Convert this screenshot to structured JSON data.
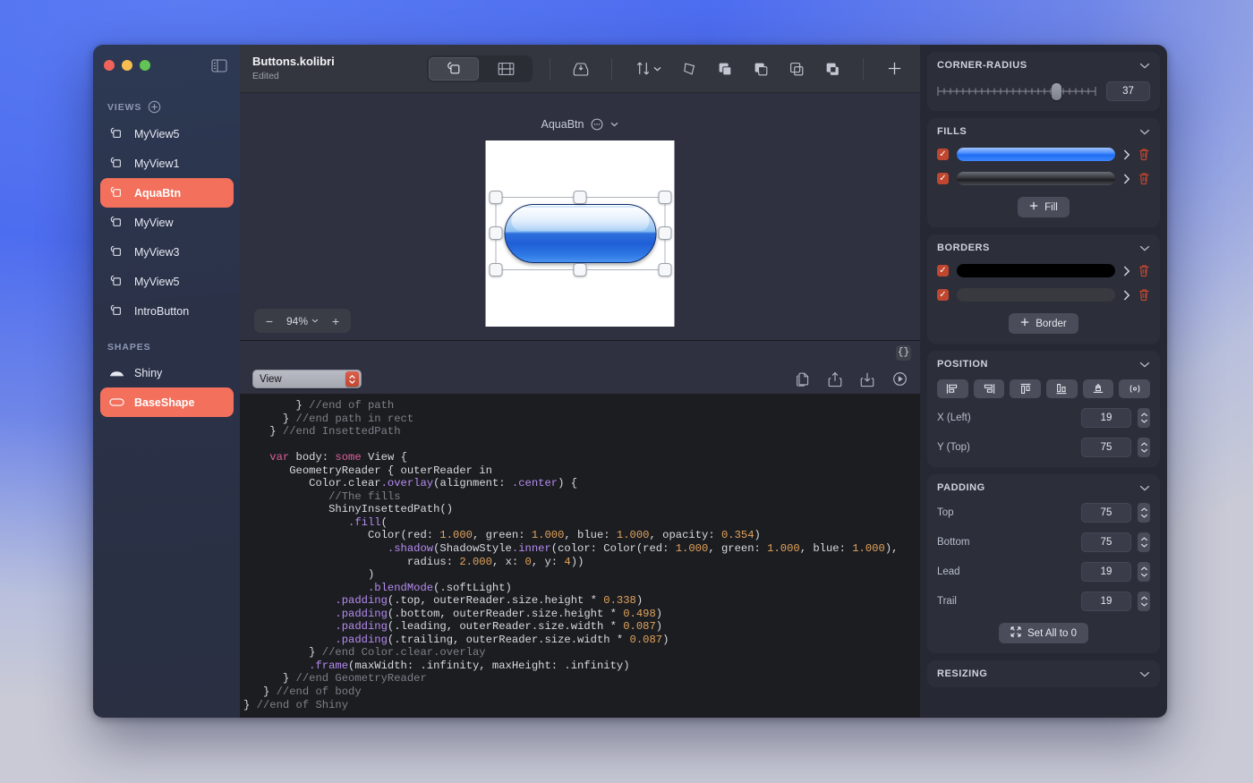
{
  "window": {
    "traffic_lights": [
      "close",
      "minimize",
      "zoom"
    ],
    "sidebar_toggle_icon": "sidebar-toggle-icon"
  },
  "sidebar": {
    "views_header": "VIEWS",
    "add_view_icon": "plus-circle-icon",
    "views": [
      {
        "label": "MyView5",
        "selected": false
      },
      {
        "label": "MyView1",
        "selected": false
      },
      {
        "label": "AquaBtn",
        "selected": true
      },
      {
        "label": "MyView",
        "selected": false
      },
      {
        "label": "MyView3",
        "selected": false
      },
      {
        "label": "MyView5",
        "selected": false
      },
      {
        "label": "IntroButton",
        "selected": false
      }
    ],
    "shapes_header": "SHAPES",
    "shapes": [
      {
        "label": "Shiny",
        "selected": false
      },
      {
        "label": "BaseShape",
        "selected": true
      }
    ]
  },
  "header": {
    "title": "Buttons.kolibri",
    "subtitle": "Edited",
    "view_mode": [
      {
        "icon": "shapes-stack-icon",
        "active": true
      },
      {
        "icon": "film-strip-icon",
        "active": false
      }
    ],
    "tools": [
      {
        "icon": "import-tray-icon",
        "label": "Import"
      },
      {
        "icon": "sort-arrows-icon",
        "label": "Sort",
        "has_chevron": true
      },
      {
        "icon": "polygon-icon",
        "label": "Polygon"
      },
      {
        "icon": "union-shapes-icon",
        "label": "Union"
      },
      {
        "icon": "subtract-shapes-icon",
        "label": "Subtract"
      },
      {
        "icon": "intersect-shapes-icon",
        "label": "Intersect"
      },
      {
        "icon": "exclude-shapes-icon",
        "label": "Exclude"
      },
      {
        "icon": "plus-icon",
        "label": "Add"
      }
    ]
  },
  "canvas": {
    "artboard_name": "AquaBtn",
    "artboard_menu_icon": "ellipsis-circle-icon",
    "artboard_chevron_icon": "chevron-down-icon",
    "zoom": {
      "minus_label": "−",
      "value": "94%",
      "plus_label": "+",
      "chevron_icon": "chevron-down-icon"
    },
    "selection_handles": 8
  },
  "editor": {
    "brace_button": "{}",
    "scope_selector": {
      "value": "View",
      "stepper_icon": "stepper-updown-icon"
    },
    "actions": [
      {
        "icon": "copy-pages-icon",
        "label": "Copy"
      },
      {
        "icon": "share-icon",
        "label": "Share"
      },
      {
        "icon": "download-icon",
        "label": "Save"
      },
      {
        "icon": "run-icon",
        "label": "Run"
      }
    ],
    "code_lines": [
      [
        {
          "t": "        } ",
          "c": "pn"
        },
        {
          "t": "//end of path",
          "c": "com"
        }
      ],
      [
        {
          "t": "      } ",
          "c": "pn"
        },
        {
          "t": "//end path in rect",
          "c": "com"
        }
      ],
      [
        {
          "t": "    } ",
          "c": "pn"
        },
        {
          "t": "//end InsettedPath",
          "c": "com"
        }
      ],
      [],
      [
        {
          "t": "    ",
          "c": "pn"
        },
        {
          "t": "var",
          "c": "kw"
        },
        {
          "t": " body: ",
          "c": "pn"
        },
        {
          "t": "some",
          "c": "kw"
        },
        {
          "t": " View {",
          "c": "pn"
        }
      ],
      [
        {
          "t": "       GeometryReader { outerReader ",
          "c": "pn"
        },
        {
          "t": "in",
          "c": "pn"
        }
      ],
      [
        {
          "t": "          Color",
          "c": "pn"
        },
        {
          "t": ".clear",
          "c": "pn"
        },
        {
          "t": ".overlay",
          "c": "fn"
        },
        {
          "t": "(alignment: ",
          "c": "pn"
        },
        {
          "t": ".center",
          "c": "fn"
        },
        {
          "t": ") {",
          "c": "pn"
        }
      ],
      [
        {
          "t": "             ",
          "c": "pn"
        },
        {
          "t": "//The fills",
          "c": "com"
        }
      ],
      [
        {
          "t": "             ShinyInsettedPath()",
          "c": "pn"
        }
      ],
      [
        {
          "t": "                ",
          "c": "pn"
        },
        {
          "t": ".fill",
          "c": "fn"
        },
        {
          "t": "(",
          "c": "pn"
        }
      ],
      [
        {
          "t": "                   Color(red: ",
          "c": "pn"
        },
        {
          "t": "1.000",
          "c": "num"
        },
        {
          "t": ", green: ",
          "c": "pn"
        },
        {
          "t": "1.000",
          "c": "num"
        },
        {
          "t": ", blue: ",
          "c": "pn"
        },
        {
          "t": "1.000",
          "c": "num"
        },
        {
          "t": ", opacity: ",
          "c": "pn"
        },
        {
          "t": "0.354",
          "c": "num"
        },
        {
          "t": ")",
          "c": "pn"
        }
      ],
      [
        {
          "t": "                      ",
          "c": "pn"
        },
        {
          "t": ".shadow",
          "c": "fn"
        },
        {
          "t": "(ShadowStyle",
          "c": "pn"
        },
        {
          "t": ".inner",
          "c": "fn"
        },
        {
          "t": "(color: Color(red: ",
          "c": "pn"
        },
        {
          "t": "1.000",
          "c": "num"
        },
        {
          "t": ", green: ",
          "c": "pn"
        },
        {
          "t": "1.000",
          "c": "num"
        },
        {
          "t": ", blue: ",
          "c": "pn"
        },
        {
          "t": "1.000",
          "c": "num"
        },
        {
          "t": "),",
          "c": "pn"
        }
      ],
      [
        {
          "t": "                         radius: ",
          "c": "pn"
        },
        {
          "t": "2.000",
          "c": "num"
        },
        {
          "t": ", x: ",
          "c": "pn"
        },
        {
          "t": "0",
          "c": "num"
        },
        {
          "t": ", y: ",
          "c": "pn"
        },
        {
          "t": "4",
          "c": "num"
        },
        {
          "t": "))",
          "c": "pn"
        }
      ],
      [
        {
          "t": "                   )",
          "c": "pn"
        }
      ],
      [
        {
          "t": "                   ",
          "c": "pn"
        },
        {
          "t": ".blendMode",
          "c": "fn"
        },
        {
          "t": "(.softLight)",
          "c": "pn"
        }
      ],
      [
        {
          "t": "              ",
          "c": "pn"
        },
        {
          "t": ".padding",
          "c": "fn"
        },
        {
          "t": "(.top, outerReader.size.height * ",
          "c": "pn"
        },
        {
          "t": "0.338",
          "c": "num"
        },
        {
          "t": ")",
          "c": "pn"
        }
      ],
      [
        {
          "t": "              ",
          "c": "pn"
        },
        {
          "t": ".padding",
          "c": "fn"
        },
        {
          "t": "(.bottom, outerReader.size.height * ",
          "c": "pn"
        },
        {
          "t": "0.498",
          "c": "num"
        },
        {
          "t": ")",
          "c": "pn"
        }
      ],
      [
        {
          "t": "              ",
          "c": "pn"
        },
        {
          "t": ".padding",
          "c": "fn"
        },
        {
          "t": "(.leading, outerReader.size.width * ",
          "c": "pn"
        },
        {
          "t": "0.087",
          "c": "num"
        },
        {
          "t": ")",
          "c": "pn"
        }
      ],
      [
        {
          "t": "              ",
          "c": "pn"
        },
        {
          "t": ".padding",
          "c": "fn"
        },
        {
          "t": "(.trailing, outerReader.size.width * ",
          "c": "pn"
        },
        {
          "t": "0.087",
          "c": "num"
        },
        {
          "t": ")",
          "c": "pn"
        }
      ],
      [
        {
          "t": "          } ",
          "c": "pn"
        },
        {
          "t": "//end Color.clear.overlay",
          "c": "com"
        }
      ],
      [
        {
          "t": "          ",
          "c": "pn"
        },
        {
          "t": ".frame",
          "c": "fn"
        },
        {
          "t": "(maxWidth: .infinity, maxHeight: .infinity)",
          "c": "pn"
        }
      ],
      [
        {
          "t": "      } ",
          "c": "pn"
        },
        {
          "t": "//end GeometryReader",
          "c": "com"
        }
      ],
      [
        {
          "t": "   } ",
          "c": "pn"
        },
        {
          "t": "//end of body",
          "c": "com"
        }
      ],
      [
        {
          "t": "} ",
          "c": "pn"
        },
        {
          "t": "//end of Shiny",
          "c": "com"
        }
      ]
    ]
  },
  "inspector": {
    "corner_radius": {
      "title": "CORNER-RADIUS",
      "value": "37",
      "slider_percent": 72
    },
    "fills": {
      "title": "FILLS",
      "rows": [
        {
          "checked": true,
          "swatch": "blue-gradient"
        },
        {
          "checked": true,
          "swatch": "dark-gradient"
        }
      ],
      "add_label": "Fill",
      "add_icon": "plus-icon"
    },
    "borders": {
      "title": "BORDERS",
      "rows": [
        {
          "checked": true,
          "swatch": "black"
        },
        {
          "checked": true,
          "swatch": "gray"
        }
      ],
      "add_label": "Border",
      "add_icon": "plus-icon"
    },
    "position": {
      "title": "POSITION",
      "align_buttons": [
        "align-left-icon",
        "align-right-icon",
        "align-top-icon",
        "align-bottom-icon",
        "align-center-horizontal-icon",
        "align-center-vertical-icon"
      ],
      "fields": [
        {
          "label": "X (Left)",
          "value": "19"
        },
        {
          "label": "Y (Top)",
          "value": "75"
        }
      ]
    },
    "padding": {
      "title": "PADDING",
      "fields": [
        {
          "label": "Top",
          "value": "75"
        },
        {
          "label": "Bottom",
          "value": "75"
        },
        {
          "label": "Lead",
          "value": "19"
        },
        {
          "label": "Trail",
          "value": "19"
        }
      ],
      "reset_label": "Set All to 0",
      "reset_icon": "arrows-collapse-icon"
    },
    "resizing": {
      "title": "RESIZING"
    }
  },
  "colors": {
    "accent": "#f2705c",
    "checkbox": "#c0472f",
    "window_bg": "#2f3140",
    "editor_bg": "#1c1d21",
    "inspector_bg": "#262833"
  }
}
